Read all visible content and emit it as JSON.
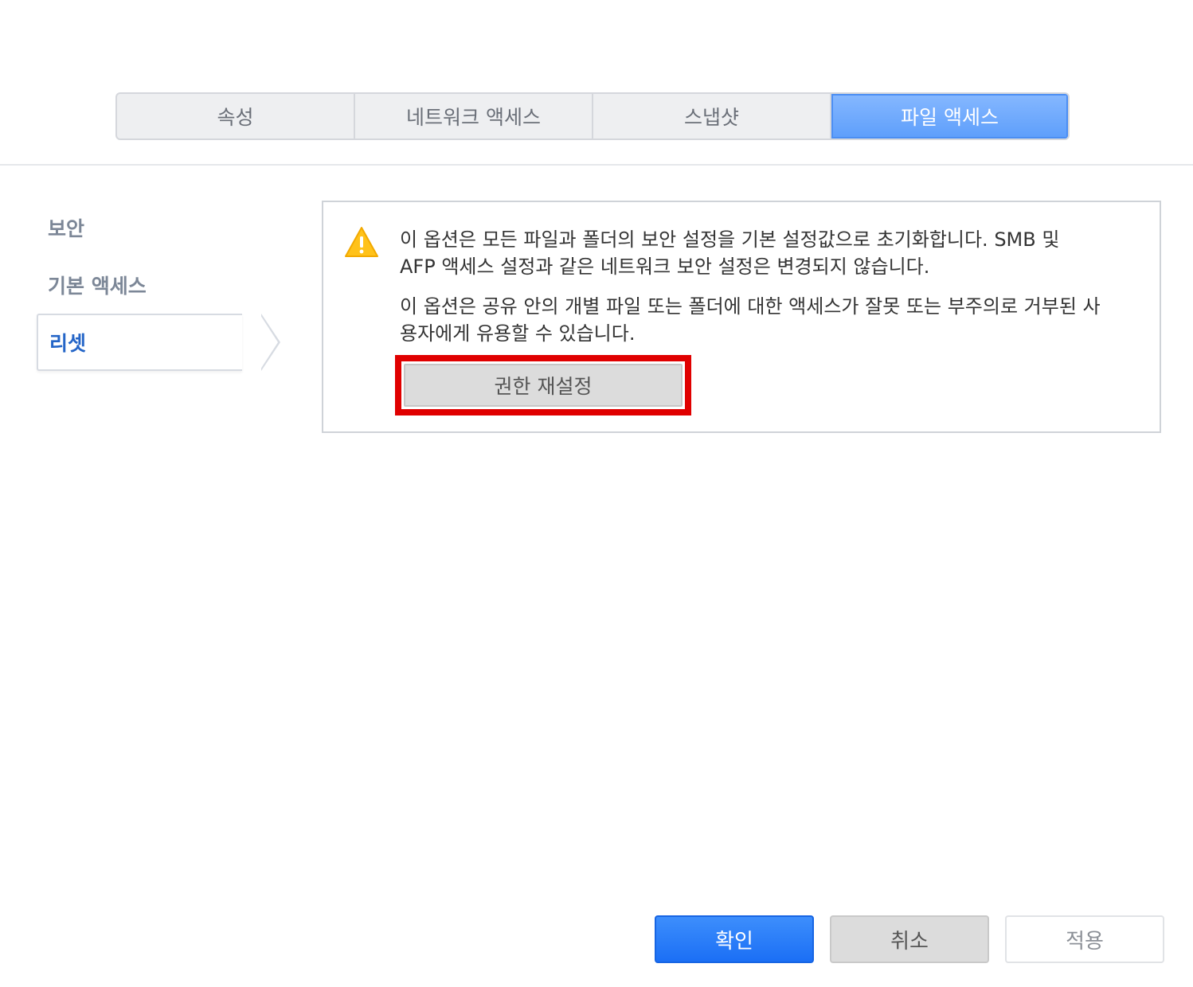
{
  "tabs": [
    {
      "label": "속성",
      "active": false
    },
    {
      "label": "네트워크 액세스",
      "active": false
    },
    {
      "label": "스냅샷",
      "active": false
    },
    {
      "label": "파일 액세스",
      "active": true
    }
  ],
  "sidebar": {
    "items": [
      {
        "label": "보안"
      },
      {
        "label": "기본 액세스"
      },
      {
        "label": "리셋",
        "active": true
      }
    ]
  },
  "main": {
    "warning_icon": "warning-triangle-icon",
    "message1": "이 옵션은 모든 파일과 폴더의 보안 설정을 기본 설정값으로 초기화합니다. SMB 및 AFP 액세스 설정과 같은 네트워크 보안 설정은 변경되지 않습니다.",
    "message2": "이 옵션은 공유 안의 개별 파일 또는 폴더에 대한 액세스가 잘못 또는 부주의로 거부된 사용자에게 유용할 수 있습니다.",
    "reset_button": "권한 재설정",
    "highlight_color": "#e00000"
  },
  "footer": {
    "ok_label": "확인",
    "cancel_label": "취소",
    "apply_label": "적용"
  },
  "colors": {
    "accent": "#5d9efb",
    "primary_button": "#1b6ff5",
    "active_nav": "#2465c7"
  }
}
